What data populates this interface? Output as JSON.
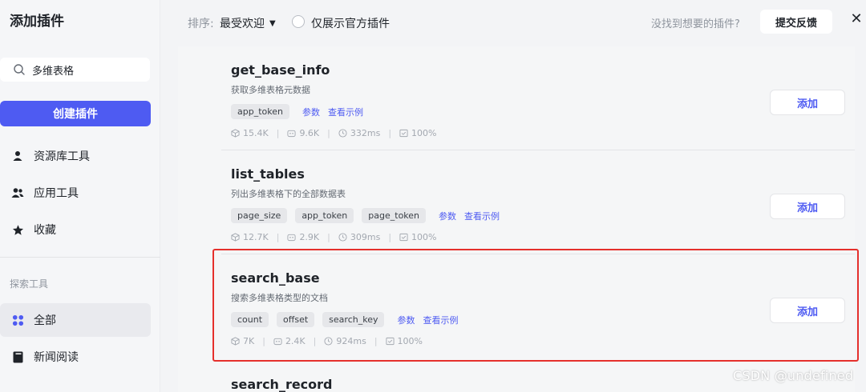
{
  "sidebar": {
    "title": "添加插件",
    "search_value": "多维表格",
    "create_button": "创建插件",
    "nav": [
      {
        "label": "资源库工具",
        "icon": "user-icon"
      },
      {
        "label": "应用工具",
        "icon": "users-icon"
      },
      {
        "label": "收藏",
        "icon": "star-icon"
      }
    ],
    "section_label": "探索工具",
    "explore": [
      {
        "label": "全部",
        "icon": "grid-icon",
        "active": true
      },
      {
        "label": "新闻阅读",
        "icon": "book-icon",
        "active": false
      }
    ]
  },
  "topbar": {
    "sort_label": "排序:",
    "sort_value": "最受欢迎",
    "official_only_label": "仅展示官方插件",
    "not_found_text": "没找到想要的插件?",
    "feedback_button": "提交反馈",
    "close_label": "✕"
  },
  "tools": [
    {
      "name": "get_base_info",
      "description": "获取多维表格元数据",
      "params": [
        "app_token"
      ],
      "params_link": "参数",
      "examples_link": "查看示例",
      "stats": {
        "usage": "15.4K",
        "bots": "9.6K",
        "latency": "332ms",
        "success": "100%"
      },
      "add_label": "添加"
    },
    {
      "name": "list_tables",
      "description": "列出多维表格下的全部数据表",
      "params": [
        "page_size",
        "app_token",
        "page_token"
      ],
      "params_link": "参数",
      "examples_link": "查看示例",
      "stats": {
        "usage": "12.7K",
        "bots": "2.9K",
        "latency": "309ms",
        "success": "100%"
      },
      "add_label": "添加"
    },
    {
      "name": "search_base",
      "description": "搜索多维表格类型的文档",
      "params": [
        "count",
        "offset",
        "search_key"
      ],
      "params_link": "参数",
      "examples_link": "查看示例",
      "stats": {
        "usage": "7K",
        "bots": "2.4K",
        "latency": "924ms",
        "success": "100%"
      },
      "add_label": "添加"
    }
  ],
  "partial_tool_name": "search_record",
  "watermark": "CSDN @undefined",
  "colors": {
    "accent": "#4e5bf2",
    "highlight": "#e5302c"
  }
}
